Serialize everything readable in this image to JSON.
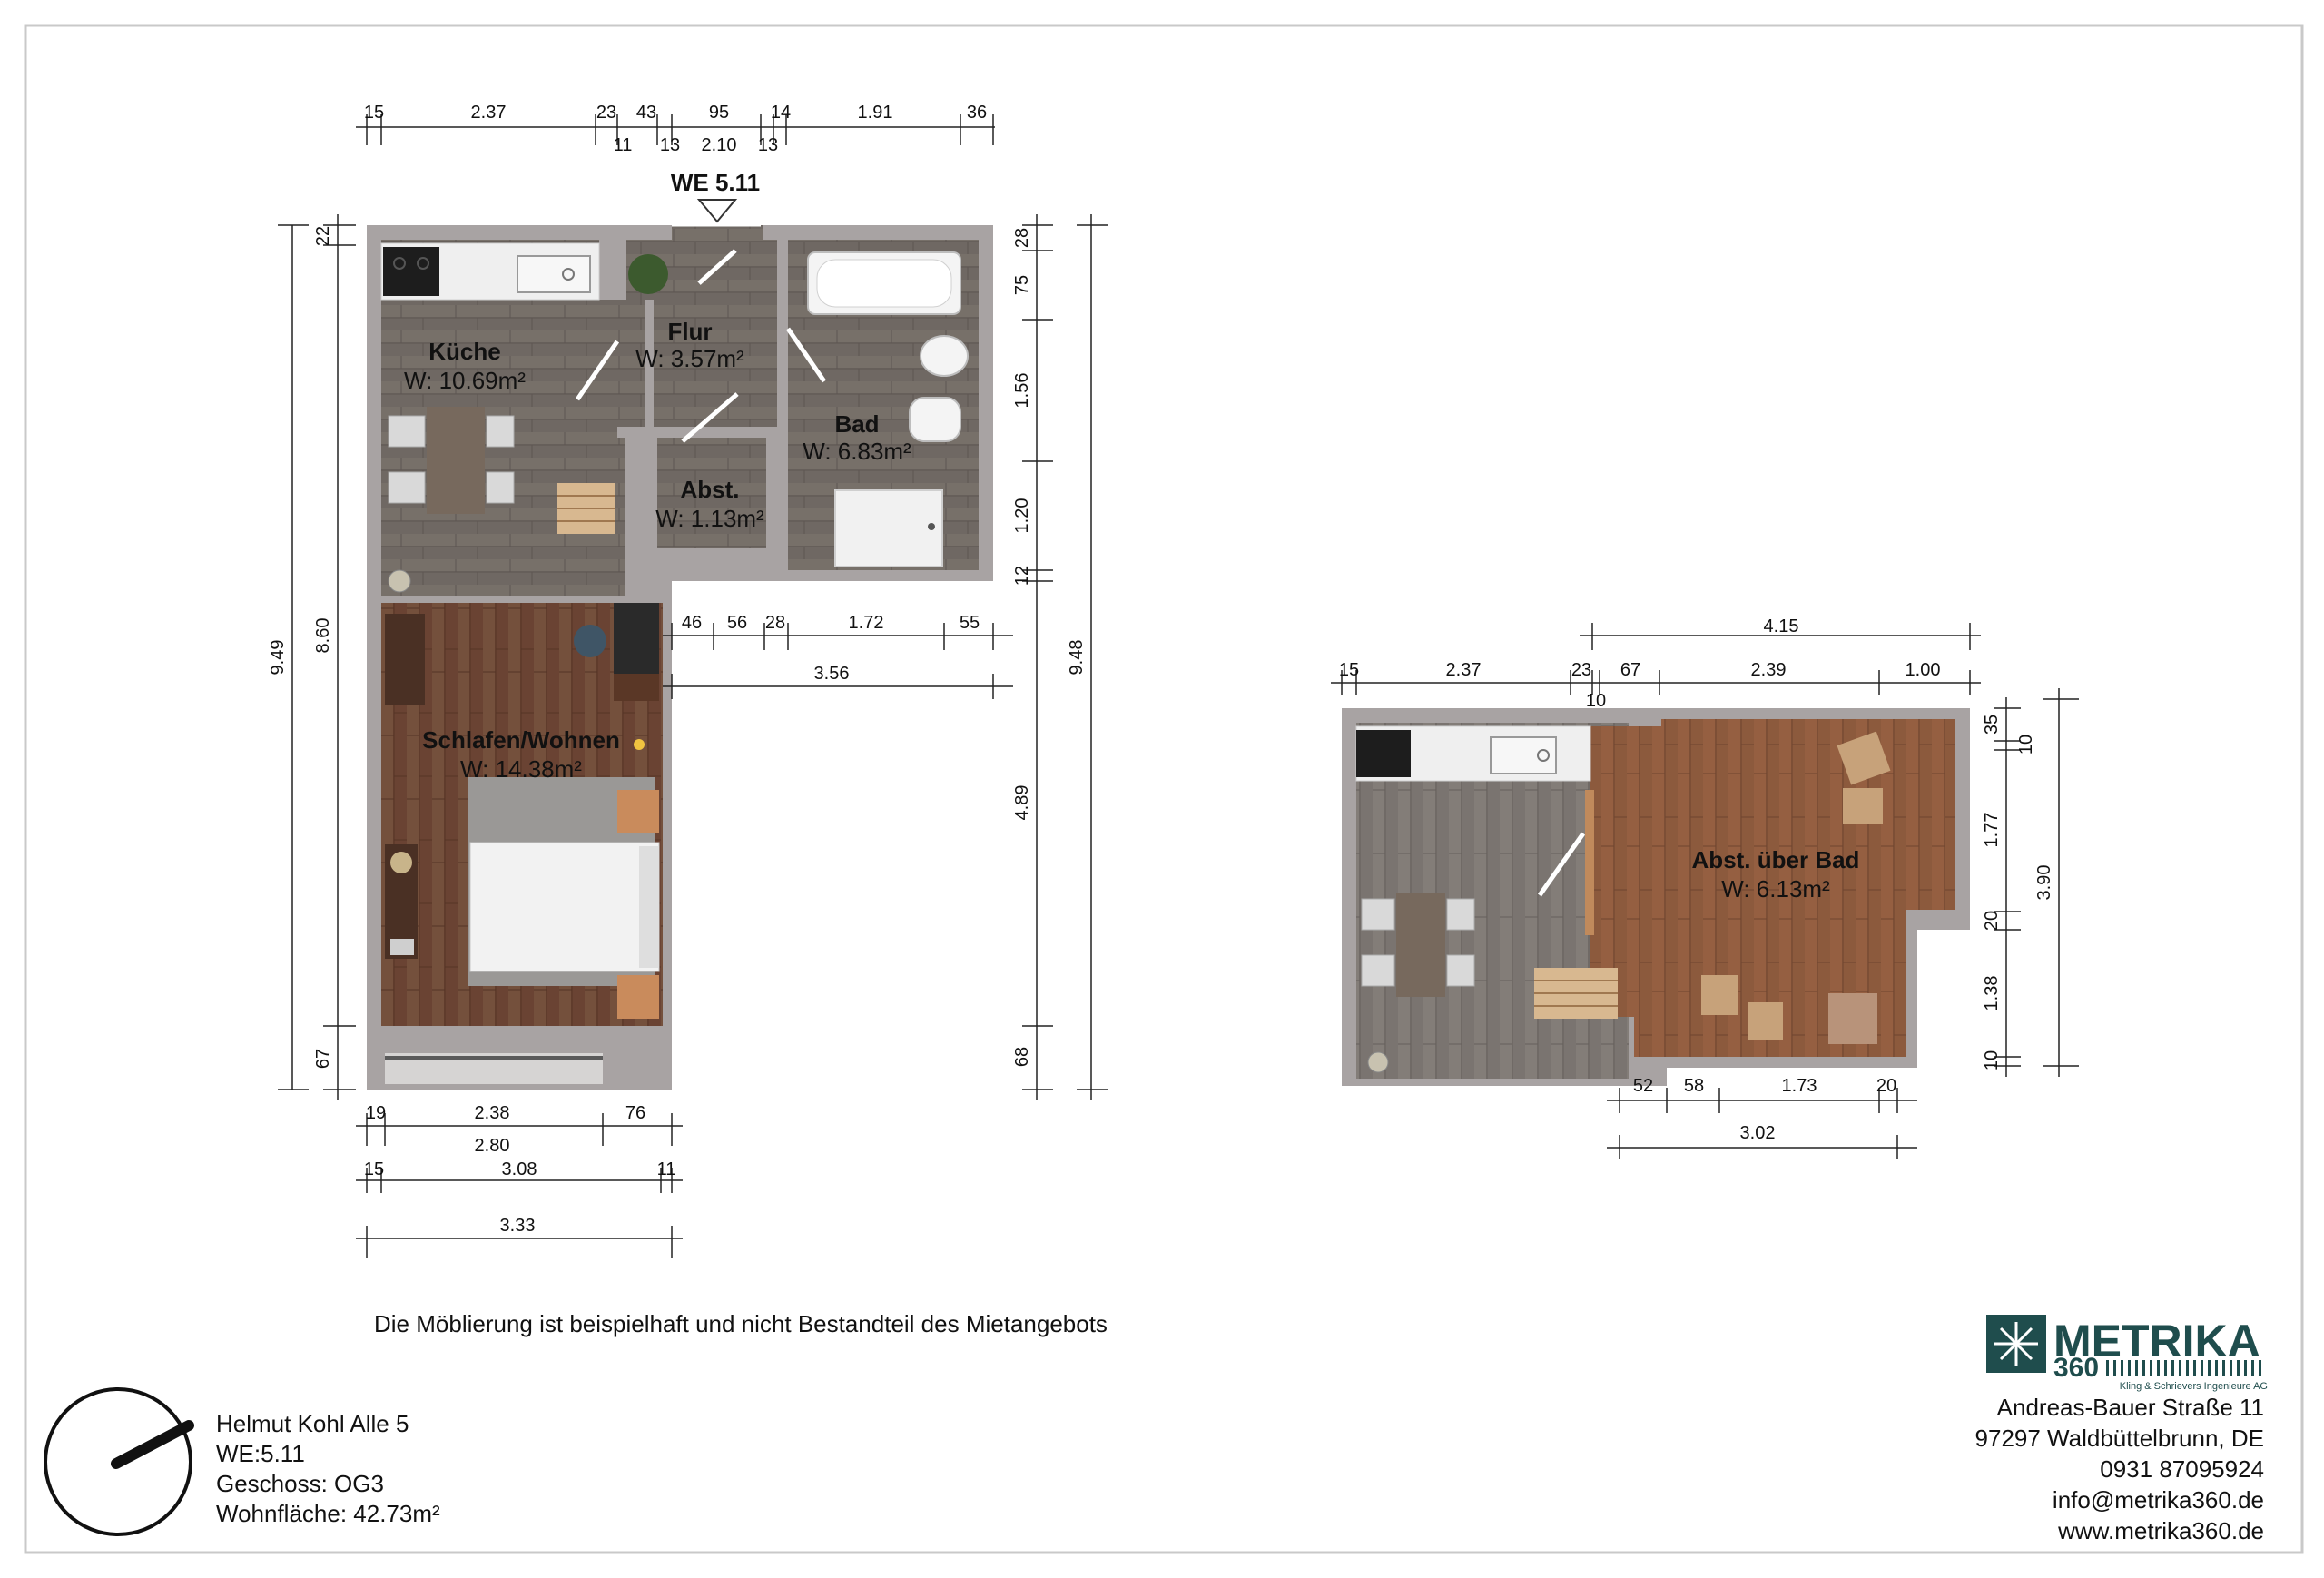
{
  "unit_label": "WE 5.11",
  "rooms": {
    "kueche": {
      "name": "Küche",
      "area": "W: 10.69m²"
    },
    "flur": {
      "name": "Flur",
      "area": "W: 3.57m²"
    },
    "bad": {
      "name": "Bad",
      "area": "W: 6.83m²"
    },
    "abst": {
      "name": "Abst.",
      "area": "W: 1.13m²"
    },
    "schlafen": {
      "name": "Schlafen/Wohnen",
      "area": "W: 14.38m²"
    },
    "abst_bad": {
      "name": "Abst. über Bad",
      "area": "W: 6.13m²"
    }
  },
  "dims_ground": {
    "top_row1": [
      "15",
      "2.37",
      "23",
      "43",
      "95",
      "14",
      "1.91",
      "36"
    ],
    "top_row2": [
      "11",
      "13",
      "2.10",
      "13"
    ],
    "left_outer": "9.49",
    "left_inner": [
      "22",
      "8.60",
      "67"
    ],
    "right_inner": [
      "28",
      "75",
      "1.56",
      "1.20",
      "12",
      "4.89",
      "68"
    ],
    "right_outer": "9.48",
    "mid_row1": [
      "46",
      "56",
      "28",
      "1.72",
      "55"
    ],
    "mid_row2": "3.56",
    "bottom_row1": [
      "19",
      "2.38",
      "76"
    ],
    "bottom_row2": "2.80",
    "bottom_row3": [
      "15",
      "3.08",
      "11"
    ],
    "bottom_row4": "3.33"
  },
  "dims_upper": {
    "top_total": "4.15",
    "top_row": [
      "15",
      "2.37",
      "23",
      "67",
      "2.39",
      "1.00"
    ],
    "top_sub": "10",
    "right_inner": [
      "35",
      "10",
      "1.77",
      "20",
      "1.38",
      "10"
    ],
    "right_outer": "3.90",
    "bottom_row1": [
      "52",
      "58",
      "1.73",
      "20"
    ],
    "bottom_row2": "3.02"
  },
  "note": "Die Möblierung ist beispielhaft und nicht Bestandteil des Mietangebots",
  "info": {
    "address": "Helmut Kohl Alle 5",
    "unit": "WE:5.11",
    "floor": "Geschoss: OG3",
    "area": "Wohnfläche: 42.73m²"
  },
  "company": {
    "logo_main": "METRIKA",
    "logo_num": "360",
    "logo_sub": "Kling & Schrievers Ingenieure AG",
    "street": "Andreas-Bauer Straße 11",
    "city": "97297 Waldbüttelbrunn, DE",
    "phone": "0931 87095924",
    "email": "info@metrika360.de",
    "web": "www.metrika360.de"
  },
  "colors": {
    "wall": "#a8a3a3",
    "wood_gray": "#6e6660",
    "wood_brown": "#6b4634",
    "wood_warm": "#8a5a3e",
    "logo_teal": "#1f4d4d"
  }
}
